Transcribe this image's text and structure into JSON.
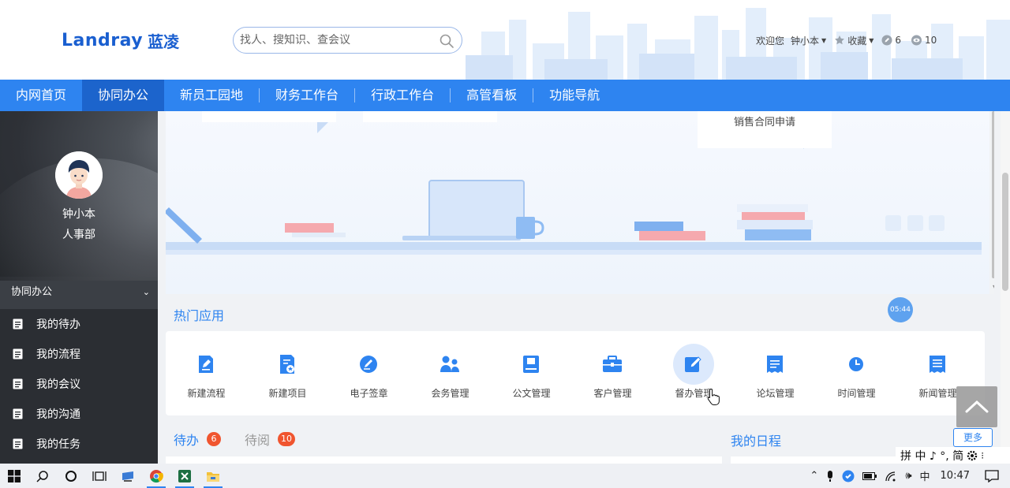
{
  "header": {
    "logo_text": "Landray",
    "logo_cn": "蓝凌",
    "search_placeholder": "找人、搜知识、查会议",
    "welcome": "欢迎您",
    "user_name": "钟小本",
    "favorites_label": "收藏",
    "edit_count": "6",
    "view_count": "10"
  },
  "nav": {
    "items": [
      {
        "label": "内网首页"
      },
      {
        "label": "协同办公",
        "active": true
      },
      {
        "label": "新员工园地"
      },
      {
        "label": "财务工作台"
      },
      {
        "label": "行政工作台"
      },
      {
        "label": "高管看板"
      },
      {
        "label": "功能导航"
      }
    ]
  },
  "sidebar": {
    "user_name": "钟小本",
    "department": "人事部",
    "section_label": "协同办公",
    "items": [
      {
        "label": "我的待办"
      },
      {
        "label": "我的流程"
      },
      {
        "label": "我的会议"
      },
      {
        "label": "我的沟通"
      },
      {
        "label": "我的任务"
      }
    ]
  },
  "banner": {
    "note_text": "销售合同申请"
  },
  "timer_text": "05:44",
  "hot_apps": {
    "title": "热门应用",
    "items": [
      {
        "label": "新建流程",
        "icon": "edit-doc-icon"
      },
      {
        "label": "新建项目",
        "icon": "project-doc-icon"
      },
      {
        "label": "电子签章",
        "icon": "signature-icon"
      },
      {
        "label": "会务管理",
        "icon": "people-icon"
      },
      {
        "label": "公文管理",
        "icon": "book-icon"
      },
      {
        "label": "客户管理",
        "icon": "briefcase-icon"
      },
      {
        "label": "督办管理",
        "icon": "supervise-icon",
        "highlighted": true
      },
      {
        "label": "论坛管理",
        "icon": "forum-icon"
      },
      {
        "label": "时间管理",
        "icon": "clock-icon"
      },
      {
        "label": "新闻管理",
        "icon": "news-icon"
      }
    ]
  },
  "tasks": {
    "todo_label": "待办",
    "todo_count": "6",
    "toread_label": "待阅",
    "toread_count": "10"
  },
  "schedule": {
    "title": "我的日程",
    "more_label": "更多"
  },
  "ime": {
    "text": "拼 中 ♪ °, 简"
  },
  "taskbar": {
    "ime_mode": "中",
    "time": "10:47"
  },
  "colors": {
    "primary": "#2e84f0",
    "nav_active": "#1c64cc",
    "sidebar_bg": "#2b2e33",
    "badge": "#f0552f"
  }
}
